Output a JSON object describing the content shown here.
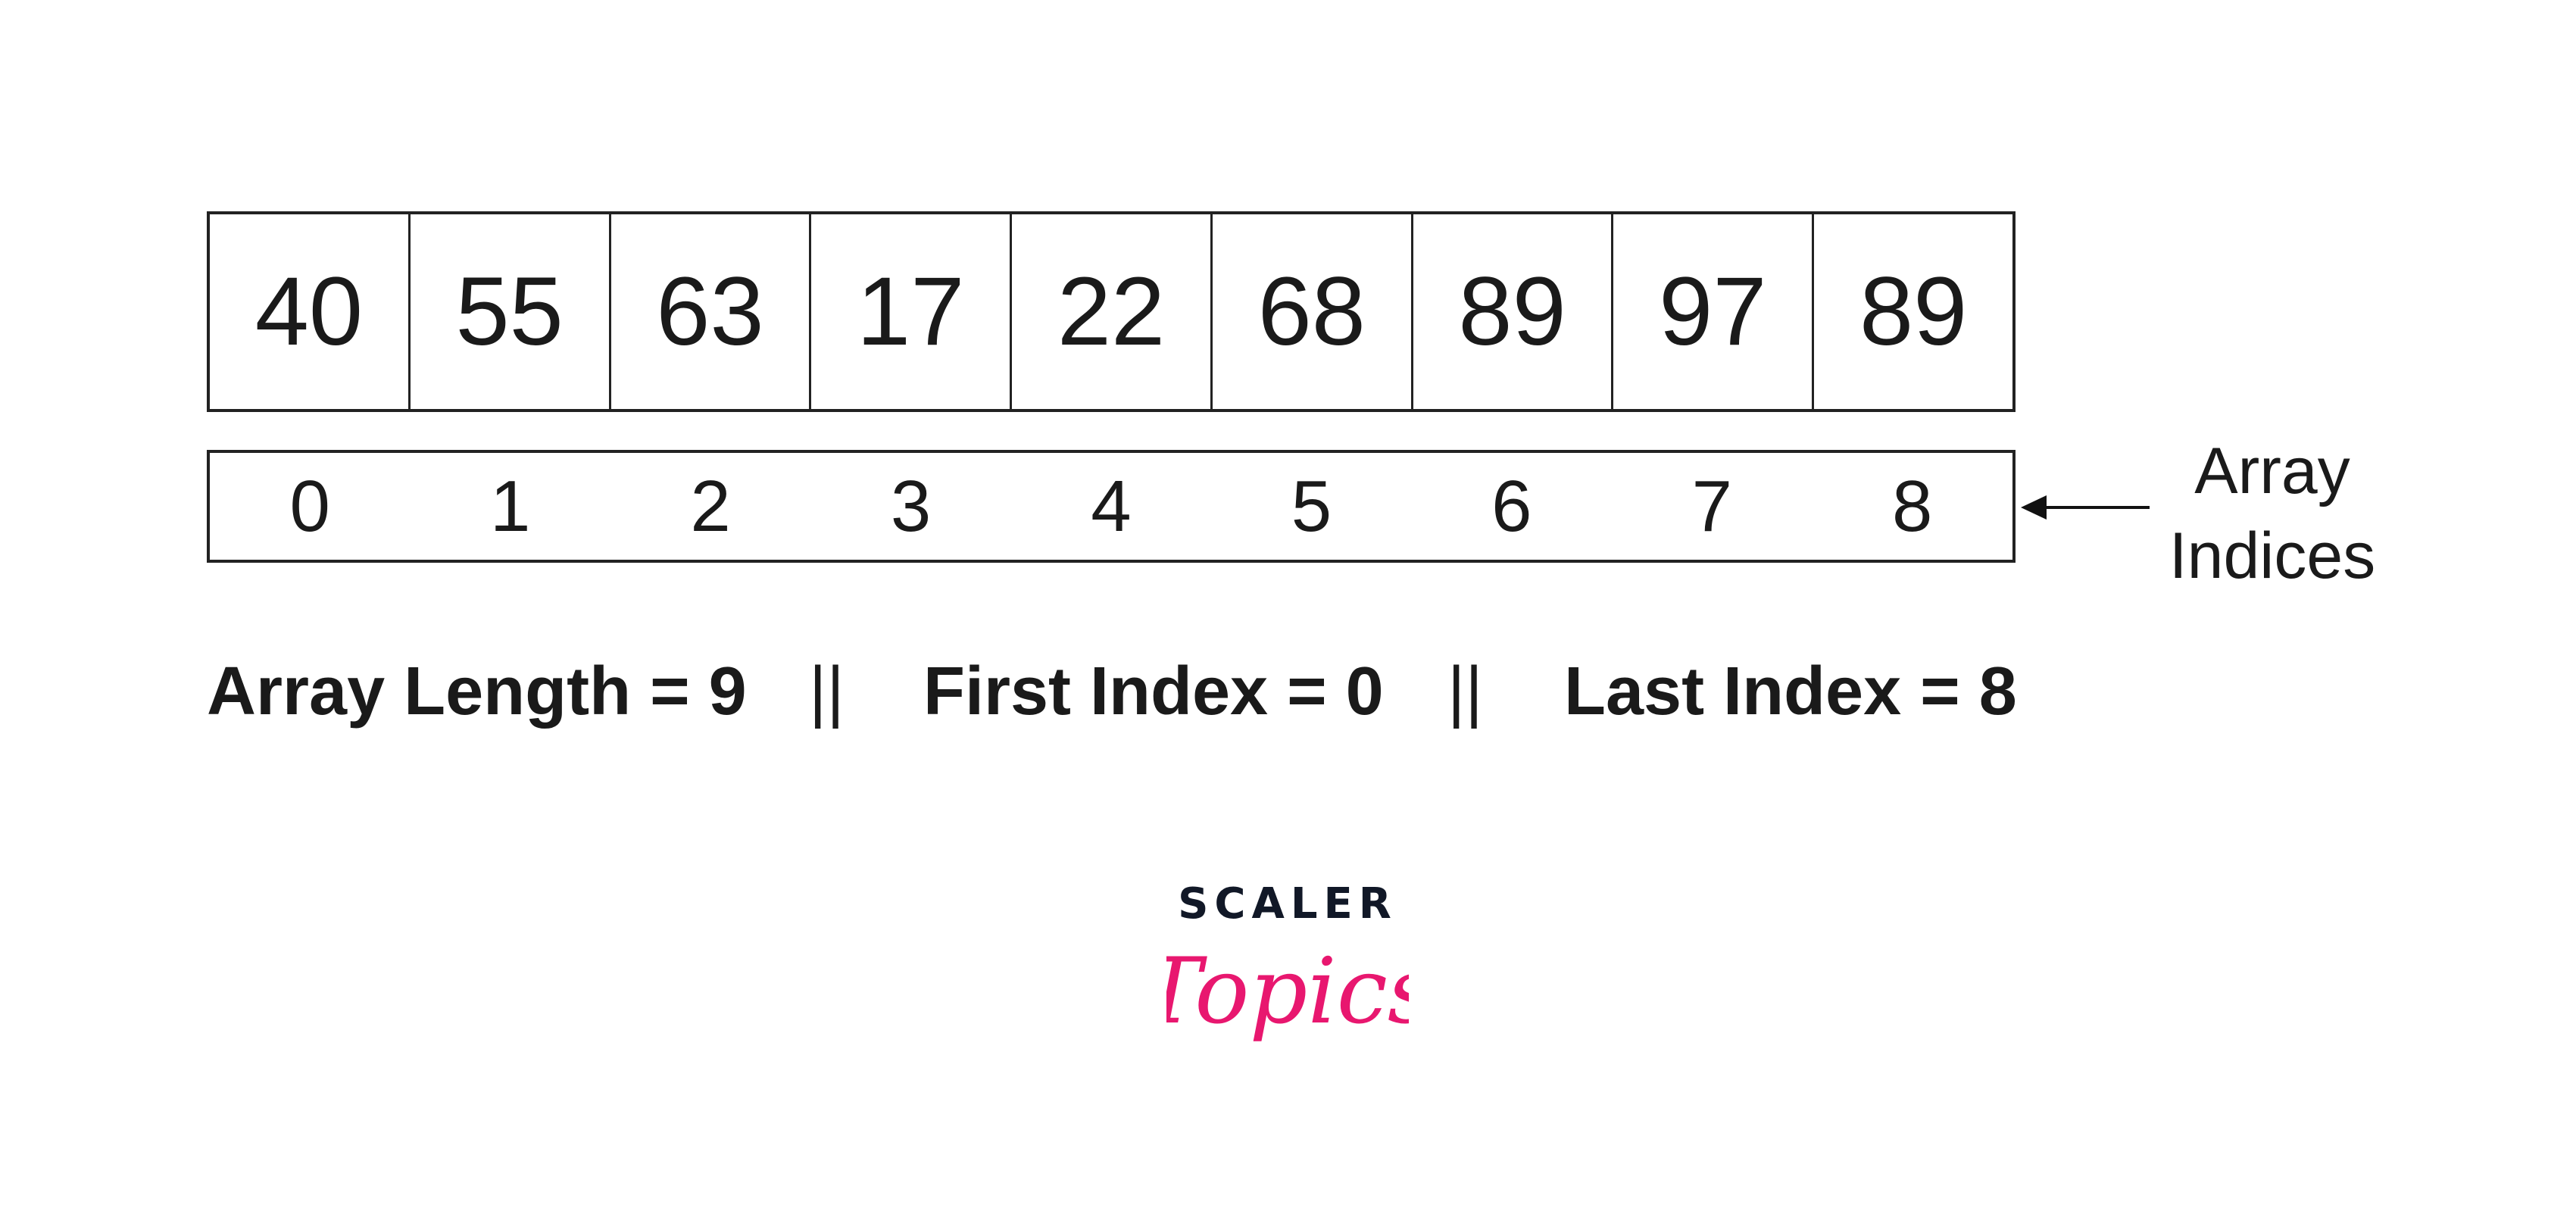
{
  "array": {
    "values": [
      "40",
      "55",
      "63",
      "17",
      "22",
      "68",
      "89",
      "97",
      "89"
    ],
    "indices": [
      "0",
      "1",
      "2",
      "3",
      "4",
      "5",
      "6",
      "7",
      "8"
    ]
  },
  "annotation": {
    "line1": "Array",
    "line2": "Indices"
  },
  "summary": {
    "length": "Array Length = 9",
    "sep1": "||",
    "first": "First Index = 0",
    "sep2": "||",
    "last": "Last Index = 8"
  },
  "logo": {
    "top": "SCALER",
    "bottom": "Topics",
    "top_color": "#111827",
    "bottom_color": "#e8176f"
  }
}
